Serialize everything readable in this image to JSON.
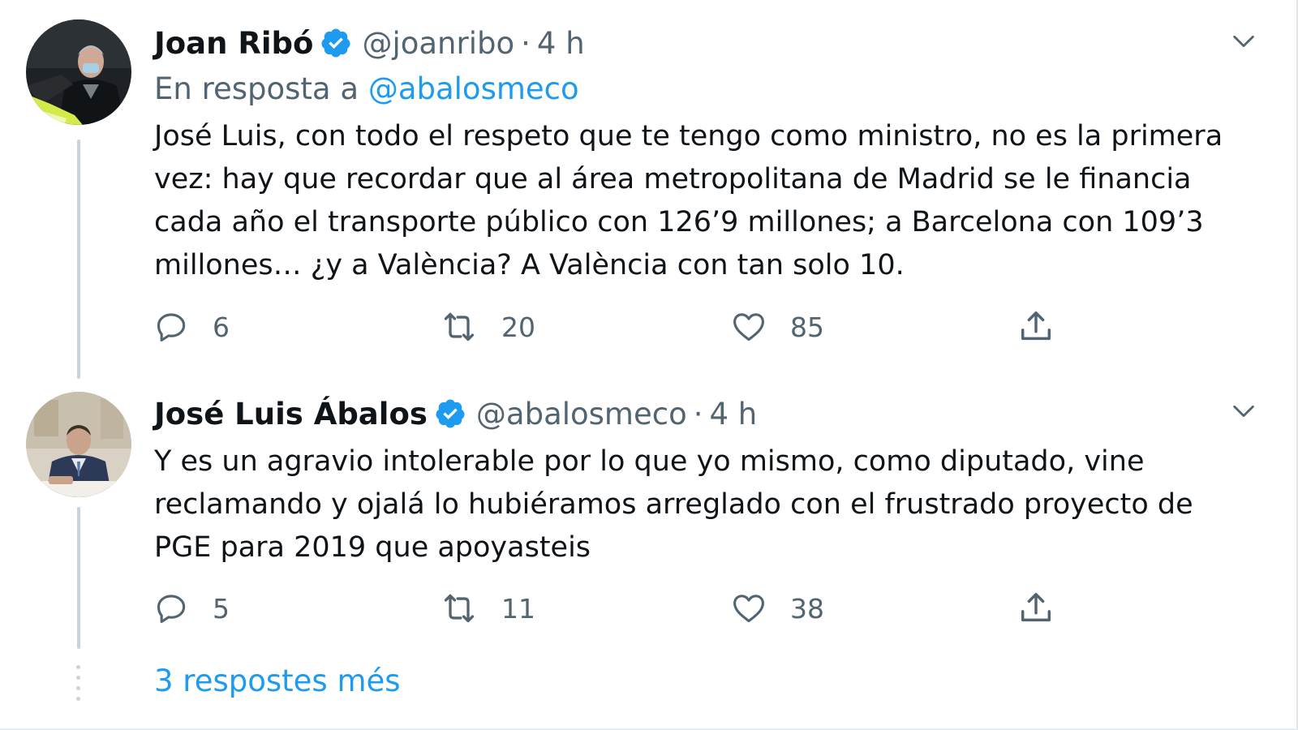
{
  "tweets": [
    {
      "name": "Joan Ribó",
      "handle": "@joanribo",
      "separator": "·",
      "time": "4 h",
      "reply_prefix": "En resposta a",
      "reply_mention": "@abalosmeco",
      "body": "José Luis, con todo el respeto que te tengo como ministro, no es la primera vez: hay que recordar que al área metropolitana de Madrid se le financia cada año el transporte público con 126’9 millones; a Barcelona con 109’3 millones… ¿y a València? A València con tan solo 10.",
      "replies": "6",
      "retweets": "20",
      "likes": "85"
    },
    {
      "name": "José Luis Ábalos",
      "handle": "@abalosmeco",
      "separator": "·",
      "time": "4 h",
      "body": "Y es un agravio intolerable por lo que yo mismo, como diputado, vine reclamando y ojalá lo hubiéramos arreglado con el frustrado proyecto de PGE para 2019 que apoyasteis",
      "replies": "5",
      "retweets": "11",
      "likes": "38"
    }
  ],
  "more_replies": "3 respostes més",
  "icons": {
    "reply": "reply-icon",
    "retweet": "retweet-icon",
    "like": "heart-icon",
    "share": "share-icon",
    "verified": "verified-badge-icon",
    "menu": "chevron-down-icon"
  },
  "colors": {
    "link": "#1d9bf0",
    "muted": "#536471",
    "text": "#0f1419",
    "verified": "#1d9bf0",
    "thread": "#c9d3db"
  }
}
